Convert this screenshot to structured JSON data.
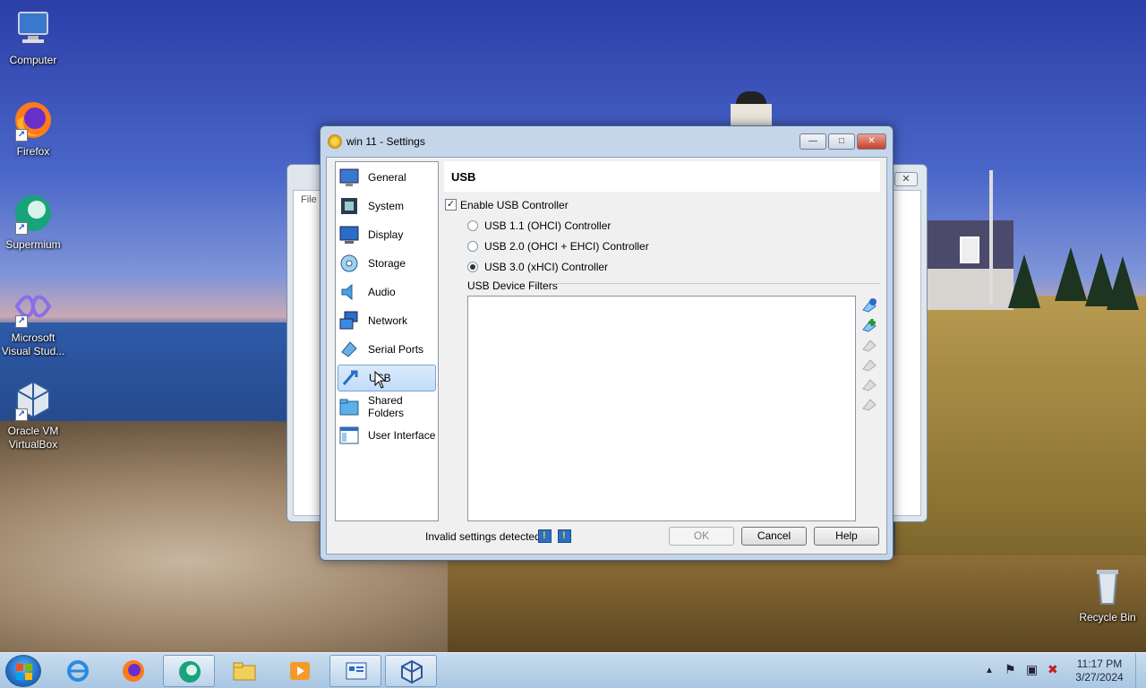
{
  "desktop": {
    "icons": [
      {
        "label": "Computer",
        "icon": "computer-icon"
      },
      {
        "label": "Firefox",
        "icon": "firefox-icon"
      },
      {
        "label": "Supermium",
        "icon": "supermium-icon"
      },
      {
        "label": "Microsoft Visual Stud...",
        "icon": "visual-studio-icon"
      },
      {
        "label": "Oracle VM VirtualBox",
        "icon": "virtualbox-icon"
      },
      {
        "label": "Recycle Bin",
        "icon": "recycle-bin-icon"
      }
    ]
  },
  "background_window": {
    "menu_file": "File",
    "close_label": "✕"
  },
  "dialog": {
    "title": "win 11 - Settings",
    "minimize_label": "—",
    "maximize_label": "□",
    "close_label": "✕",
    "nav": [
      {
        "label": "General",
        "icon": "general-icon"
      },
      {
        "label": "System",
        "icon": "system-icon"
      },
      {
        "label": "Display",
        "icon": "display-icon"
      },
      {
        "label": "Storage",
        "icon": "storage-icon"
      },
      {
        "label": "Audio",
        "icon": "audio-icon"
      },
      {
        "label": "Network",
        "icon": "network-icon"
      },
      {
        "label": "Serial Ports",
        "icon": "serial-ports-icon"
      },
      {
        "label": "USB",
        "icon": "usb-icon"
      },
      {
        "label": "Shared Folders",
        "icon": "shared-folders-icon"
      },
      {
        "label": "User Interface",
        "icon": "user-interface-icon"
      }
    ],
    "selected_nav": "USB",
    "section_title": "USB",
    "enable_usb_label": "Enable USB Controller",
    "enable_usb_checked": true,
    "controllers": [
      {
        "label": "USB 1.1 (OHCI) Controller",
        "selected": false
      },
      {
        "label": "USB 2.0 (OHCI + EHCI) Controller",
        "selected": false
      },
      {
        "label": "USB 3.0 (xHCI) Controller",
        "selected": true
      }
    ],
    "filters_label": "USB Device Filters",
    "filter_buttons": [
      "add-filter-icon",
      "add-from-device-icon",
      "edit-filter-icon",
      "remove-filter-icon",
      "move-up-icon",
      "move-down-icon"
    ],
    "status_text": "Invalid settings detected",
    "ok_label": "OK",
    "cancel_label": "Cancel",
    "help_label": "Help"
  },
  "taskbar": {
    "apps": [
      "internet-explorer-icon",
      "firefox-icon",
      "supermium-icon",
      "file-explorer-icon",
      "media-player-icon",
      "control-panel-icon",
      "virtualbox-icon"
    ],
    "clock_time": "11:17 PM",
    "clock_date": "3/27/2024"
  },
  "colors": {
    "selection": "#c1dcfa",
    "dialog_frame": "#c5d6ea",
    "taskbar": "#b9d2ea"
  }
}
